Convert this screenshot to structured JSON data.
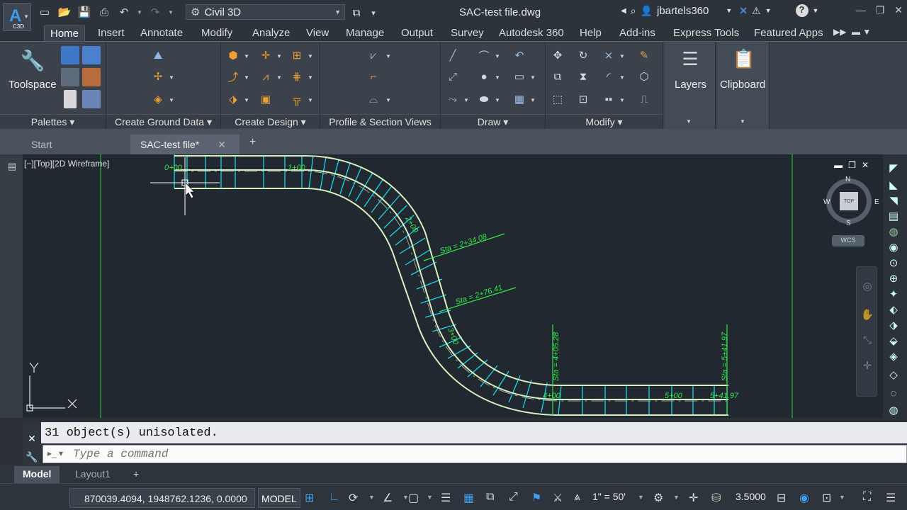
{
  "app": {
    "logo_letter": "A",
    "logo_sub": "C3D"
  },
  "workspace": {
    "value": "Civil 3D"
  },
  "title": "SAC-test file.dwg",
  "user": {
    "name": "jbartels360"
  },
  "ribbon_tabs": [
    "Home",
    "Insert",
    "Annotate",
    "Modify",
    "Analyze",
    "View",
    "Manage",
    "Output",
    "Survey",
    "Autodesk 360",
    "Help",
    "Add-ins",
    "Express Tools",
    "Featured Apps"
  ],
  "panels": {
    "palettes": "Palettes",
    "ground": "Create Ground Data",
    "design": "Create Design",
    "profile": "Profile & Section Views",
    "draw": "Draw",
    "modify": "Modify"
  },
  "big_buttons": {
    "toolspace": "Toolspace",
    "layers": "Layers",
    "clipboard": "Clipboard"
  },
  "doc_tabs": {
    "start": "Start",
    "active": "SAC-test file*"
  },
  "viewport": {
    "label": "[−][Top][2D Wireframe]"
  },
  "viewcube": {
    "top": "TOP",
    "n": "N",
    "s": "S",
    "e": "E",
    "w": "W",
    "wcs": "WCS"
  },
  "ucs": {
    "y": "Y",
    "x": "X"
  },
  "drawing_labels": {
    "st1": "Sta = 2+34.08",
    "st2": "Sta = 2+76.41",
    "st3": "Sta = 4+05.28",
    "st4": "Sta = 5+41.97",
    "s0": "0+00",
    "s1": "1+00",
    "s4": "4+00",
    "s5": "5+00",
    "s541": "5+41.97",
    "s2": "2+00",
    "s3": "3+00"
  },
  "command": {
    "output": "31 object(s) unisolated.",
    "placeholder": "Type a command"
  },
  "layout_tabs": {
    "model": "Model",
    "layout1": "Layout1"
  },
  "status": {
    "coords": "870039.4094, 1948762.1236, 0.0000",
    "model": "MODEL",
    "scale": "1\" = 50'",
    "anno_value": "3.5000"
  }
}
